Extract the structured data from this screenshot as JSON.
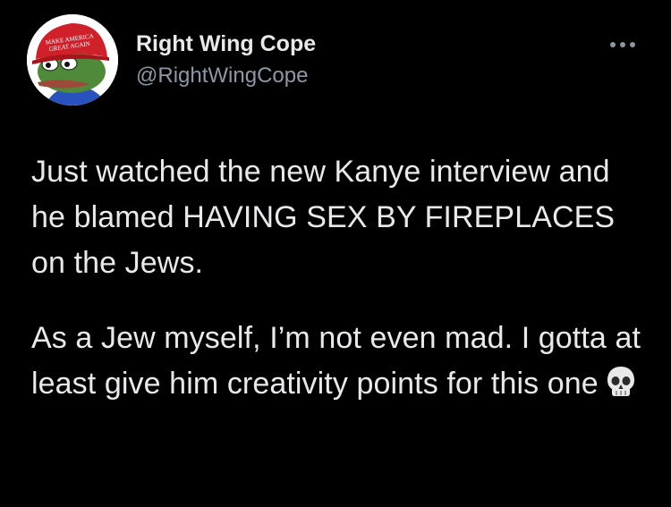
{
  "tweet": {
    "display_name": "Right Wing Cope",
    "handle": "@RightWingCope",
    "avatar_hat_text_line1": "MAKE AMERICA",
    "avatar_hat_text_line2": "GREAT AGAIN",
    "more_icon": "more-horizontal-icon",
    "paragraphs": [
      "Just watched the new Kanye interview and he blamed HAVING SEX BY FIREPLACES on the Jews.",
      "As a Jew myself, I’m not even mad. I gotta at least give him creativity points for this one"
    ],
    "emoji": "skull-icon"
  },
  "colors": {
    "background": "#000000",
    "primary_text": "#e7e9ea",
    "secondary_text": "#8b98a5"
  }
}
